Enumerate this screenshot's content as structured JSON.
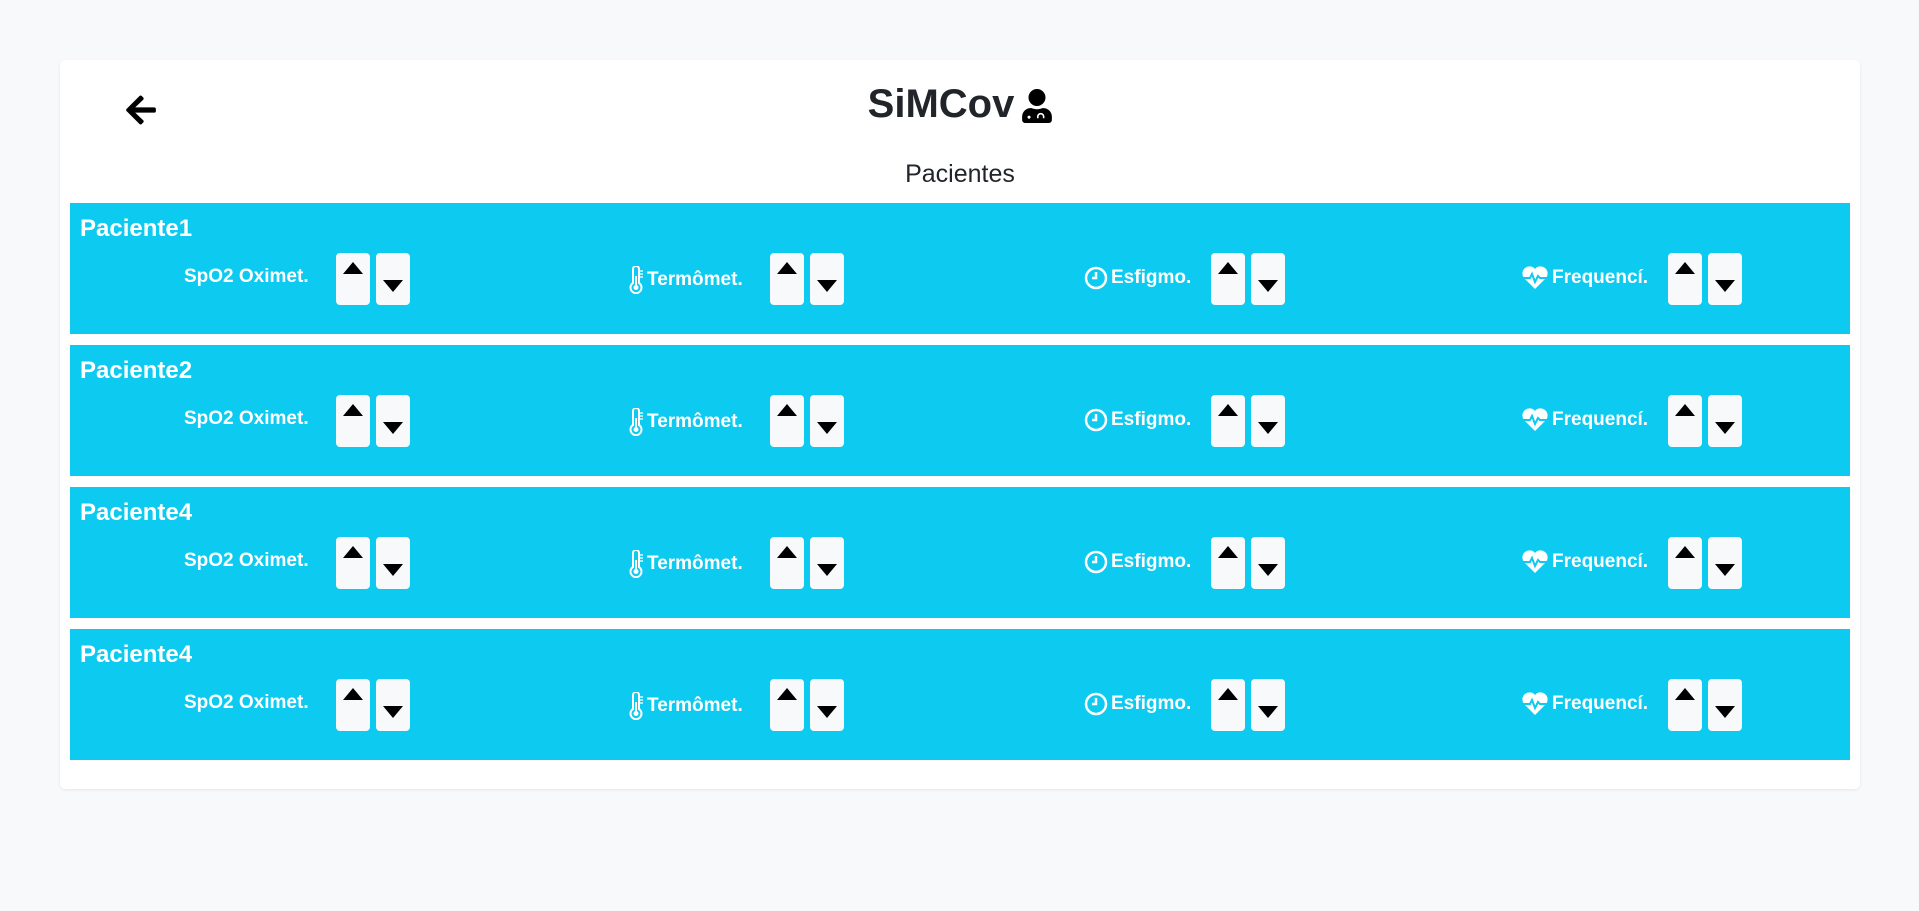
{
  "header": {
    "title": "SiMCov",
    "subtitle": "Pacientes"
  },
  "sensors": [
    {
      "label": "SpO2 Oximet.",
      "icon": "none"
    },
    {
      "label": "Termômet.",
      "icon": "thermometer-icon"
    },
    {
      "label": "Esfigmo.",
      "icon": "clock-icon"
    },
    {
      "label": "Frequencí.",
      "icon": "heart-pulse-icon"
    }
  ],
  "patients": [
    {
      "name": "Paciente1"
    },
    {
      "name": "Paciente2"
    },
    {
      "name": "Paciente4"
    },
    {
      "name": "Paciente4"
    }
  ],
  "colors": {
    "row_background": "#0dcaf0",
    "button_background": "#f8f9fa",
    "page_background": "#f8f9fa"
  }
}
